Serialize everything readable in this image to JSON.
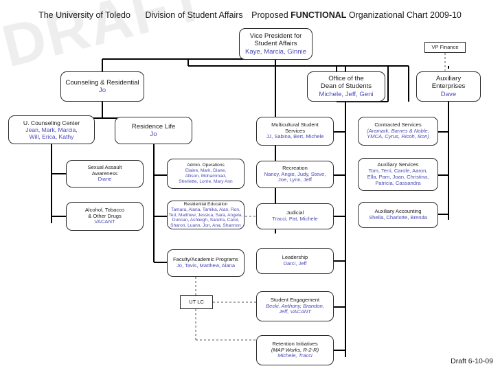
{
  "document": {
    "title_parts": {
      "institution": "The University of Toledo",
      "division": "Division of Student Affairs",
      "proposed": "Proposed",
      "emphasis": "FUNCTIONAL",
      "suffix": "Organizational Chart 2009-10"
    },
    "watermark": "DRAFT",
    "footer": "Draft 6-10-09",
    "accent_people_color": "#4a4ab4",
    "text_color": "#1a1a1a",
    "line_color": "#000000",
    "watermark_color": "#eeeeee"
  },
  "nodes": {
    "vp_student_affairs": {
      "title_line1": "Vice President for",
      "title_line2": "Student Affairs",
      "people": "Kaye, Marcia, Ginnie"
    },
    "vp_finance": {
      "title": "VP Finance"
    },
    "counseling_residential": {
      "title": "Counseling & Residential",
      "people": "Jo"
    },
    "office_dean_students": {
      "title_line1": "Office of the",
      "title_line2": "Dean of Students",
      "people": "Michele, Jeff, Geni"
    },
    "auxiliary_enterprises": {
      "title_line1": "Auxiliary",
      "title_line2": "Enterprises",
      "people": "Dave"
    },
    "u_counseling_center": {
      "title": "U. Counseling Center",
      "people_line1": "Jean, Mark, Marcia,",
      "people_line2": "Will, Erica, Kathy"
    },
    "residence_life": {
      "title": "Residence Life",
      "people": "Jo"
    },
    "multicultural_student_services": {
      "title_line1": "Multicultural Student",
      "title_line2": "Services",
      "people": "JJ, Sabina, Bert, Michele"
    },
    "contracted_services": {
      "title": "Contracted Services",
      "people_line1": "(Aramark, Barnes & Noble,",
      "people_line2": "YMCA, Cyrus, Ricoh, Ikon)"
    },
    "sexual_assault_awareness": {
      "title_line1": "Sexual Assault",
      "title_line2": "Awareness",
      "people": "Diane"
    },
    "admin_operations": {
      "title": "Admin. Operations",
      "people_line1": "Elaine, Mark, Diane,",
      "people_line2": "Allison, Mohammad,",
      "people_line3": "Sherlette, Lorrie, Mary Ann"
    },
    "recreation": {
      "title": "Recreation",
      "people_line1": "Nancy, Angie, Judy, Steve,",
      "people_line2": "Joe, Lynn, Jeff"
    },
    "auxiliary_services": {
      "title": "Auxiliary Services",
      "people_line1": "Tom, Terri, Carole, Aaron,",
      "people_line2": "Ella, Pam, Joan, Christina,",
      "people_line3": "Patricia, Cassandra"
    },
    "alcohol_tobacco_other_drugs": {
      "title_line1": "Alcohol, Tobacco",
      "title_line2": "& Other Drugs",
      "people": "VACANT"
    },
    "residential_education": {
      "title": "Residential Education",
      "people_line1": "Tamara, Alana, Tamika, Alan, Ron,",
      "people_line2": "Teri, Matthew, Jessica, Sara, Angela,",
      "people_line3": "Duncan, Ashleigh, Sandra, Carol,",
      "people_line4": "Sharon, Luann, Jon, Ana, Shannon"
    },
    "judicial": {
      "title": "Judicial",
      "people": "Tracci, Pat, Michele"
    },
    "auxiliary_accounting": {
      "title": "Auxiliary Accounting",
      "people": "Shella, Charlotte, Brenda"
    },
    "faculty_academic_programs": {
      "title": "Faculty/Academic Programs",
      "people": "Jo, Tavis, Matthew, Alana"
    },
    "leadership": {
      "title": "Leadership",
      "people": "Darci, Jeff"
    },
    "ut_lc": {
      "title": "UT LC"
    },
    "student_engagement": {
      "title": "Student Engagement",
      "people_line1": "Becki, Anthony, Brandon,",
      "people_line2": "Jeff, VACANT"
    },
    "retention_initiatives": {
      "title": "Retention Initiatives",
      "program": "(MAP Works, R-2-R)",
      "people": "Michele, Tracci"
    }
  }
}
